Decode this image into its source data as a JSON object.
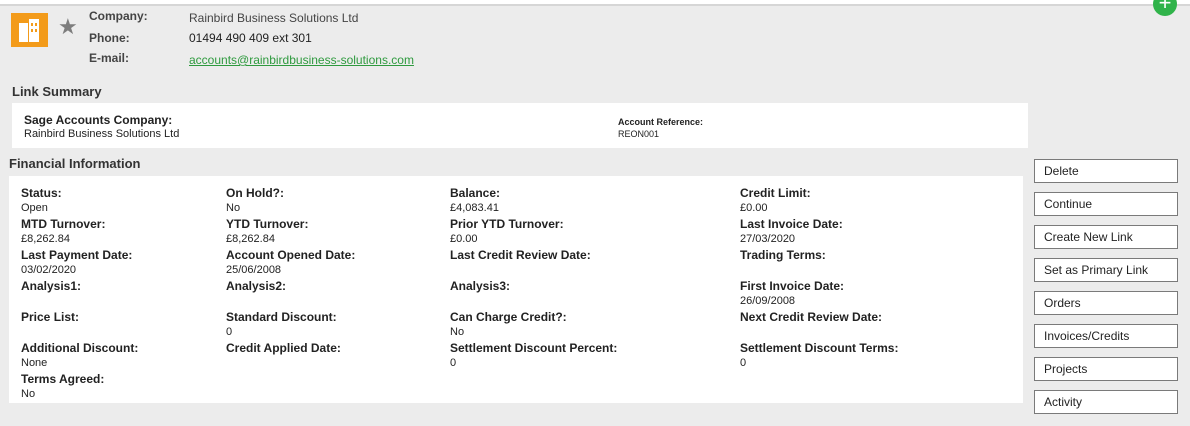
{
  "header": {
    "company_label": "Company:",
    "company_value": "Rainbird Business Solutions Ltd",
    "phone_label": "Phone:",
    "phone_value": "01494 490 409 ext 301",
    "email_label": "E-mail:",
    "email_value": "accounts@rainbirdbusiness-solutions.com",
    "logo_icon": "company-building-icon",
    "star_icon": "favourite-star-icon",
    "add_icon": "plus-icon",
    "add_label": "+"
  },
  "link_summary": {
    "title": "Link Summary",
    "sage_company_label": "Sage Accounts Company:",
    "sage_company_value": "Rainbird Business Solutions Ltd",
    "account_ref_label": "Account Reference:",
    "account_ref_value": "REON001"
  },
  "financial": {
    "title": "Financial Information",
    "fields": [
      {
        "label": "Status:",
        "value": "Open"
      },
      {
        "label": "On Hold?:",
        "value": "No"
      },
      {
        "label": "Balance:",
        "value": "£4,083.41"
      },
      {
        "label": "Credit Limit:",
        "value": "£0.00"
      },
      {
        "label": "MTD Turnover:",
        "value": "£8,262.84"
      },
      {
        "label": "YTD Turnover:",
        "value": "£8,262.84"
      },
      {
        "label": "Prior YTD Turnover:",
        "value": "£0.00"
      },
      {
        "label": "Last Invoice Date:",
        "value": "27/03/2020"
      },
      {
        "label": "Last Payment Date:",
        "value": "03/02/2020"
      },
      {
        "label": "Account Opened Date:",
        "value": "25/06/2008"
      },
      {
        "label": "Last Credit Review Date:",
        "value": ""
      },
      {
        "label": "Trading Terms:",
        "value": ""
      },
      {
        "label": "Analysis1:",
        "value": ""
      },
      {
        "label": "Analysis2:",
        "value": ""
      },
      {
        "label": "Analysis3:",
        "value": ""
      },
      {
        "label": "First Invoice Date:",
        "value": "26/09/2008"
      },
      {
        "label": "Price List:",
        "value": ""
      },
      {
        "label": "Standard Discount:",
        "value": "0"
      },
      {
        "label": "Can Charge Credit?:",
        "value": "No"
      },
      {
        "label": "Next Credit Review Date:",
        "value": ""
      },
      {
        "label": "Additional Discount:",
        "value": "None"
      },
      {
        "label": "Credit Applied Date:",
        "value": ""
      },
      {
        "label": "Settlement Discount Percent:",
        "value": "0"
      },
      {
        "label": "Settlement Discount Terms:",
        "value": "0"
      },
      {
        "label": "Terms Agreed:",
        "value": "No"
      }
    ]
  },
  "actions": {
    "buttons": [
      "Delete",
      "Continue",
      "Create New Link",
      "Set as Primary Link",
      "Orders",
      "Invoices/Credits",
      "Projects",
      "Activity"
    ]
  }
}
